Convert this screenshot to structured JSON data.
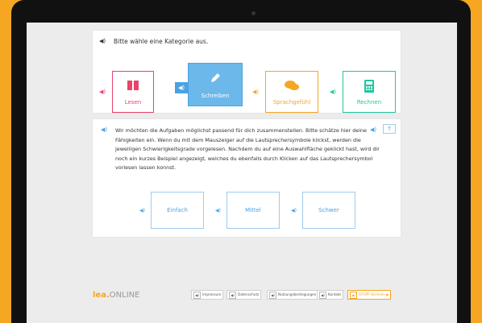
{
  "category_prompt": "Bitte wähle eine Kategorie aus.",
  "categories": [
    {
      "label": "Lesen",
      "icon": "book-icon",
      "color": "#e9436b"
    },
    {
      "label": "Schreiben",
      "icon": "pencil-icon",
      "color": "#4aa3df",
      "selected": true
    },
    {
      "label": "Sprachgefühl",
      "icon": "speech-bubbles-icon",
      "color": "#f5a623"
    },
    {
      "label": "Rechnen",
      "icon": "calculator-icon",
      "color": "#1ec8a0"
    }
  ],
  "intro_text": "Wir möchten die Aufgaben möglichst passend für dich zusammenstellen. Bitte schätze hier deine Fähigkeiten ein. Wenn du mit dem Mauszeiger auf die Lautsprechersymbole klickst, werden die jeweiligen Schwierigkeitsgrade vorgelesen. Nachdem du auf eine Auswahlfläche geklickt hast, wird dir noch ein kurzes Beispiel angezeigt, welches du ebenfalls durch Klicken auf das Lautsprechersymbol vorlesen lassen konnst.",
  "levels": [
    "Einfach",
    "Mittel",
    "Schwer"
  ],
  "logo": {
    "brand": "lea.",
    "suffix": "ONLINE"
  },
  "footer": {
    "imprint": "Impressum",
    "privacy": "Datenschutz",
    "terms": "Nutzungsbedingungen",
    "contact": "Kontakt",
    "stop": "STOPP Vorlesen"
  }
}
